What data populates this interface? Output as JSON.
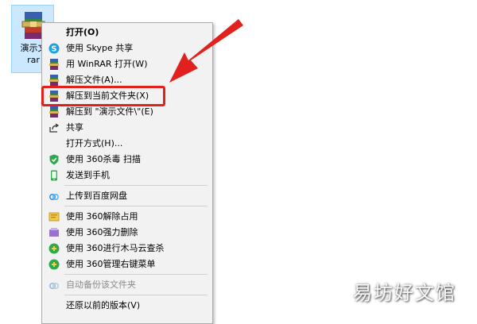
{
  "desktop_file": {
    "name_line1": "演示文",
    "name_line2": "rar",
    "icon": "winrar-archive-icon"
  },
  "context_menu": {
    "items": [
      {
        "label": "打开(O)",
        "icon": "none",
        "bold": true
      },
      {
        "label": "使用 Skype 共享",
        "icon": "skype-icon"
      },
      {
        "label": "用 WinRAR 打开(W)",
        "icon": "winrar-icon"
      },
      {
        "label": "解压文件(A)...",
        "icon": "winrar-icon"
      },
      {
        "label": "解压到当前文件夹(X)",
        "icon": "winrar-icon",
        "highlighted": true
      },
      {
        "label": "解压到 \"演示文件\\\"(E)",
        "icon": "winrar-icon"
      },
      {
        "label": "共享",
        "icon": "share-icon"
      },
      {
        "label": "打开方式(H)...",
        "icon": "none"
      },
      {
        "label": "使用 360杀毒 扫描",
        "icon": "360-antivirus-icon"
      },
      {
        "label": "发送到手机",
        "icon": "phone-icon"
      },
      {
        "label": "上传到百度网盘",
        "icon": "baidu-netdisk-icon"
      },
      {
        "label": "使用 360解除占用",
        "icon": "360-unlock-icon"
      },
      {
        "label": "使用 360强力删除",
        "icon": "360-shred-icon"
      },
      {
        "label": "使用 360进行木马云查杀",
        "icon": "360-cloud-scan-icon"
      },
      {
        "label": "使用 360管理右键菜单",
        "icon": "360-menu-manager-icon"
      },
      {
        "label": "自动备份该文件夹",
        "icon": "baidu-netdisk-icon",
        "disabled": true
      },
      {
        "label": "还原以前的版本(V)",
        "icon": "none"
      }
    ]
  },
  "annotation": {
    "color": "#e0211d"
  },
  "watermark": {
    "text": "易坊好文馆"
  }
}
